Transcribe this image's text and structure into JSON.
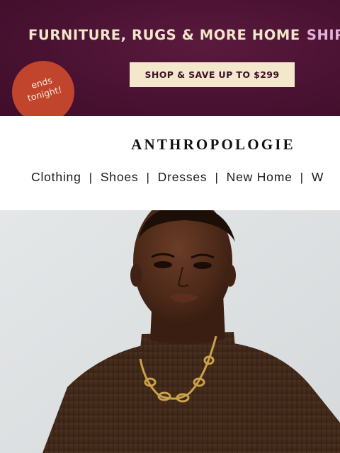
{
  "promo": {
    "headline": "FURNITURE, RUGS & MORE HOME",
    "headline_accent": "SHIP",
    "cta": "SHOP & SAVE UP TO $299",
    "badge": "ends tonight!",
    "colors": {
      "background": "#4a1232",
      "headline": "#f1e6c8",
      "accent": "#e3b2dc",
      "button_bg": "#f3e8cc",
      "badge_bg": "#c1452c"
    }
  },
  "header": {
    "logo": "ANTHROPOLOGIE"
  },
  "nav": {
    "items": [
      {
        "label": "Clothing"
      },
      {
        "label": "Shoes"
      },
      {
        "label": "Dresses"
      },
      {
        "label": "New Home"
      },
      {
        "label": "W"
      }
    ],
    "separator": "|"
  },
  "hero": {
    "image": "model in brown ribbed mock-neck sweater wearing gold chain necklace"
  }
}
